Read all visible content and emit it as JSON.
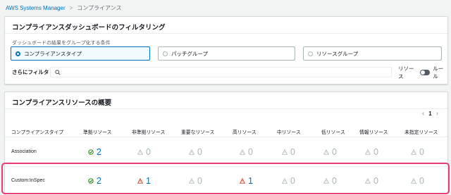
{
  "breadcrumb": {
    "root": "AWS Systems Manager",
    "current": "コンプライアンス"
  },
  "filter_panel": {
    "title": "コンプライアンスダッシュボードのフィルタリング",
    "criteria_label": "ダッシュボードの結果をグループ化する条件",
    "options": [
      "コンプライアンスタイプ",
      "パッチグループ",
      "リソースグループ"
    ],
    "selected_option": "コンプライアンスタイプ",
    "filter_label": "さらにフィルタ",
    "filter_value": "",
    "toggle_left": "リソース",
    "toggle_right": "ルール"
  },
  "summary_panel": {
    "title": "コンプライアンスリソースの概要",
    "pagination": {
      "current_page": "1",
      "prev": "‹",
      "next": "›"
    },
    "columns": [
      "コンプライアンスタイプ",
      "準拠リソース",
      "非準拠リソース",
      "重要なリソース",
      "高リソース",
      "中リソース",
      "低リソース",
      "情報リソース",
      "未指定リソース"
    ],
    "rows": [
      {
        "type": "Association",
        "values": [
          "2",
          "0",
          "0",
          "0",
          "0",
          "0",
          "0",
          "0"
        ]
      },
      {
        "type": "Custom:InSpec",
        "values": [
          "2",
          "1",
          "0",
          "1",
          "0",
          "0",
          "0",
          "0"
        ]
      }
    ]
  },
  "colors": {
    "link": "#0073bb",
    "compliant": "#1d8102",
    "warning": "#d13212",
    "muted": "#aab7b8",
    "highlight": "#e83e6f"
  },
  "icons": {
    "compliant": "check-circle-icon",
    "noncompliant": "warning-triangle-icon",
    "zero": "grey-triangle-icon"
  }
}
